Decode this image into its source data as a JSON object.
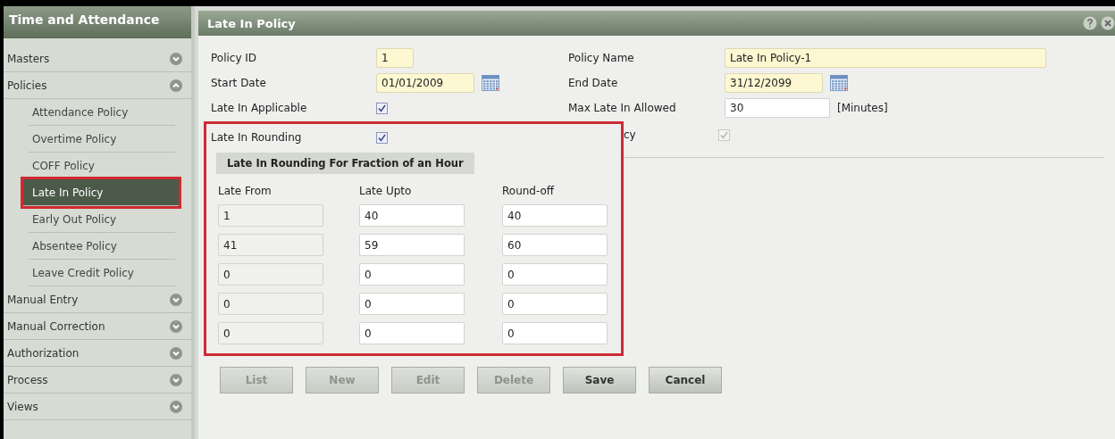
{
  "sidebar": {
    "title": "Time and Attendance",
    "items": [
      {
        "label": "Masters",
        "expanded": false
      },
      {
        "label": "Policies",
        "expanded": true,
        "children": [
          {
            "label": "Attendance Policy",
            "selected": false
          },
          {
            "label": "Overtime Policy",
            "selected": false
          },
          {
            "label": "COFF Policy",
            "selected": false
          },
          {
            "label": "Late In Policy",
            "selected": true
          },
          {
            "label": "Early Out Policy",
            "selected": false
          },
          {
            "label": "Absentee Policy",
            "selected": false
          },
          {
            "label": "Leave Credit Policy",
            "selected": false
          }
        ]
      },
      {
        "label": "Manual Entry",
        "expanded": false
      },
      {
        "label": "Manual Correction",
        "expanded": false
      },
      {
        "label": "Authorization",
        "expanded": false
      },
      {
        "label": "Process",
        "expanded": false
      },
      {
        "label": "Views",
        "expanded": false
      }
    ]
  },
  "window": {
    "title": "Late In Policy"
  },
  "form": {
    "policy_id": {
      "label": "Policy ID",
      "value": "1"
    },
    "policy_name": {
      "label": "Policy Name",
      "value": "Late In Policy-1"
    },
    "start_date": {
      "label": "Start Date",
      "value": "01/01/2009"
    },
    "end_date": {
      "label": "End Date",
      "value": "31/12/2099"
    },
    "late_in_applicable": {
      "label": "Late In Applicable",
      "checked": true
    },
    "max_late_in_allowed": {
      "label": "Max Late In Allowed",
      "value": "30",
      "unit": "[Minutes]"
    },
    "late_in_rounding": {
      "label": "Late In Rounding",
      "checked": true
    },
    "partial_label": {
      "label": "cy",
      "checked": true,
      "disabled": true
    }
  },
  "rounding": {
    "title": "Late In Rounding For Fraction of an Hour",
    "columns": [
      "Late From",
      "Late Upto",
      "Round-off"
    ],
    "rows": [
      [
        "1",
        "40",
        "40"
      ],
      [
        "41",
        "59",
        "60"
      ],
      [
        "0",
        "0",
        "0"
      ],
      [
        "0",
        "0",
        "0"
      ],
      [
        "0",
        "0",
        "0"
      ]
    ]
  },
  "buttons": [
    {
      "label": "List",
      "disabled": true
    },
    {
      "label": "New",
      "disabled": true
    },
    {
      "label": "Edit",
      "disabled": true
    },
    {
      "label": "Delete",
      "disabled": true
    },
    {
      "label": "Save",
      "disabled": false
    },
    {
      "label": "Cancel",
      "disabled": false
    }
  ]
}
